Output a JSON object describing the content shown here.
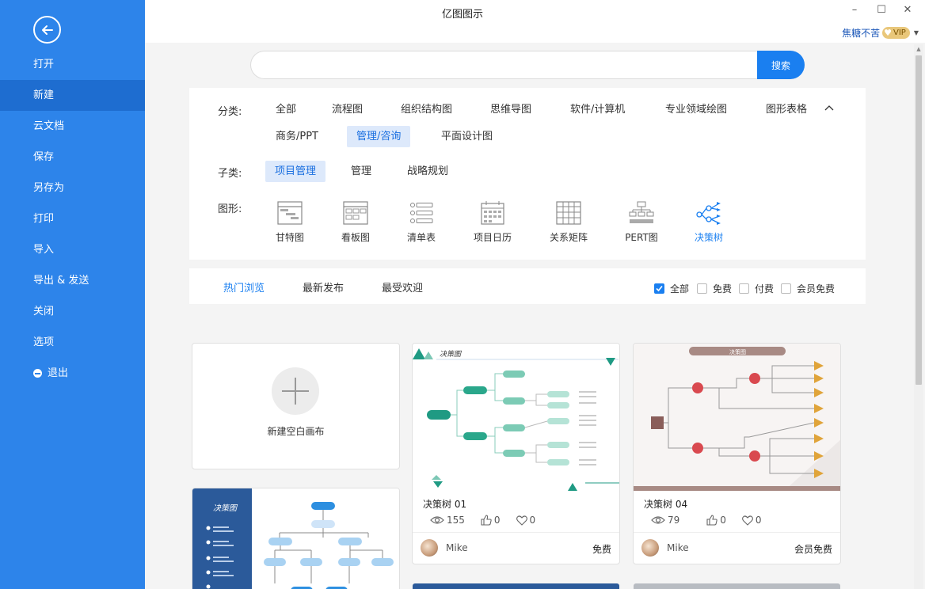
{
  "app": {
    "title": "亿图图示"
  },
  "window": {
    "minimize": "–",
    "maximize": "☐",
    "close": "✕"
  },
  "user": {
    "name": "焦糖不苦",
    "vip": "VIP"
  },
  "sidebar": {
    "items": [
      {
        "label": "打开",
        "name": "sidebar-item-open"
      },
      {
        "label": "新建",
        "name": "sidebar-item-new",
        "active": true
      },
      {
        "label": "云文档",
        "name": "sidebar-item-cloud-docs"
      },
      {
        "label": "保存",
        "name": "sidebar-item-save"
      },
      {
        "label": "另存为",
        "name": "sidebar-item-save-as"
      },
      {
        "label": "打印",
        "name": "sidebar-item-print"
      },
      {
        "label": "导入",
        "name": "sidebar-item-import"
      },
      {
        "label": "导出 & 发送",
        "name": "sidebar-item-export-send"
      },
      {
        "label": "关闭",
        "name": "sidebar-item-close"
      },
      {
        "label": "选项",
        "name": "sidebar-item-options"
      },
      {
        "label": "退出",
        "name": "sidebar-item-exit",
        "icon": "minus-circle-icon"
      }
    ]
  },
  "search": {
    "value": "",
    "placeholder": "",
    "button": "搜索"
  },
  "filters": {
    "category_label": "分类:",
    "categories": [
      "全部",
      "流程图",
      "组织结构图",
      "思维导图",
      "软件/计算机",
      "专业领域绘图",
      "图形表格",
      "商务/PPT",
      "管理/咨询",
      "平面设计图"
    ],
    "category_active": "管理/咨询",
    "subcategory_label": "子类:",
    "subcategories": [
      "项目管理",
      "管理",
      "战略规划"
    ],
    "subcategory_active": "项目管理",
    "shape_label": "图形:",
    "shapes": [
      {
        "label": "甘特图",
        "icon": "gantt-chart-icon"
      },
      {
        "label": "看板图",
        "icon": "kanban-board-icon"
      },
      {
        "label": "清单表",
        "icon": "checklist-icon"
      },
      {
        "label": "项目日历",
        "icon": "project-calendar-icon"
      },
      {
        "label": "关系矩阵",
        "icon": "relation-matrix-icon"
      },
      {
        "label": "PERT图",
        "icon": "pert-chart-icon"
      },
      {
        "label": "决策树",
        "icon": "decision-tree-icon",
        "active": true
      }
    ]
  },
  "sort": {
    "tabs": [
      "热门浏览",
      "最新发布",
      "最受欢迎"
    ],
    "active": "热门浏览",
    "price_filters": [
      {
        "label": "全部",
        "checked": true
      },
      {
        "label": "免费",
        "checked": false
      },
      {
        "label": "付费",
        "checked": false
      },
      {
        "label": "会员免费",
        "checked": false
      }
    ]
  },
  "new_canvas": {
    "label": "新建空白画布"
  },
  "templates": [
    {
      "title": "决策树 01",
      "views": "155",
      "likes": "0",
      "favorites": "0",
      "author": "Mike",
      "price": "免费",
      "thumb_heading": "决策图"
    },
    {
      "title": "决策树 04",
      "views": "79",
      "likes": "0",
      "favorites": "0",
      "author": "Mike",
      "price": "会员免费",
      "thumb_heading": "决策图"
    }
  ],
  "preview_card": {
    "heading": "决策图"
  },
  "colors": {
    "sidebar": "#2d84ea",
    "accent": "#1a7ff0",
    "active_chip_bg": "#dde9fb",
    "vip_gold": "#e9c77a"
  }
}
